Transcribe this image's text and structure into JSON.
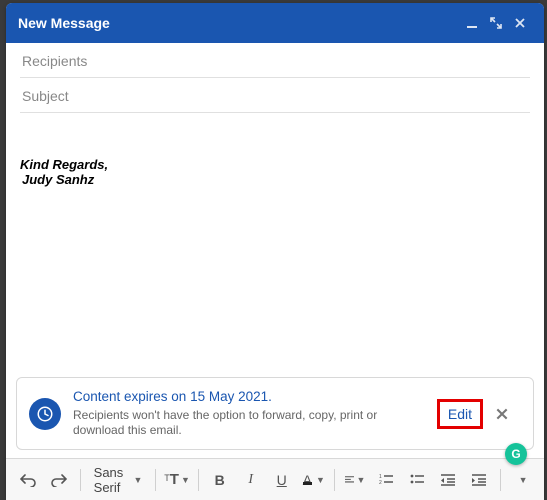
{
  "window": {
    "title": "New Message"
  },
  "fields": {
    "recipients_placeholder": "Recipients",
    "subject_placeholder": "Subject"
  },
  "body": {
    "signature_line1": "Kind Regards,",
    "signature_line2": "Judy Sanhz"
  },
  "confidential": {
    "title": "Content expires on 15 May 2021.",
    "desc": "Recipients won't have the option to forward, copy, print or download this email.",
    "edit_label": "Edit"
  },
  "toolbar": {
    "font_name": "Sans Serif",
    "size_glyph": "ᵀT",
    "bold": "B",
    "italic": "I",
    "underline": "U",
    "textcolor": "A"
  },
  "grammarly": {
    "glyph": "G"
  }
}
